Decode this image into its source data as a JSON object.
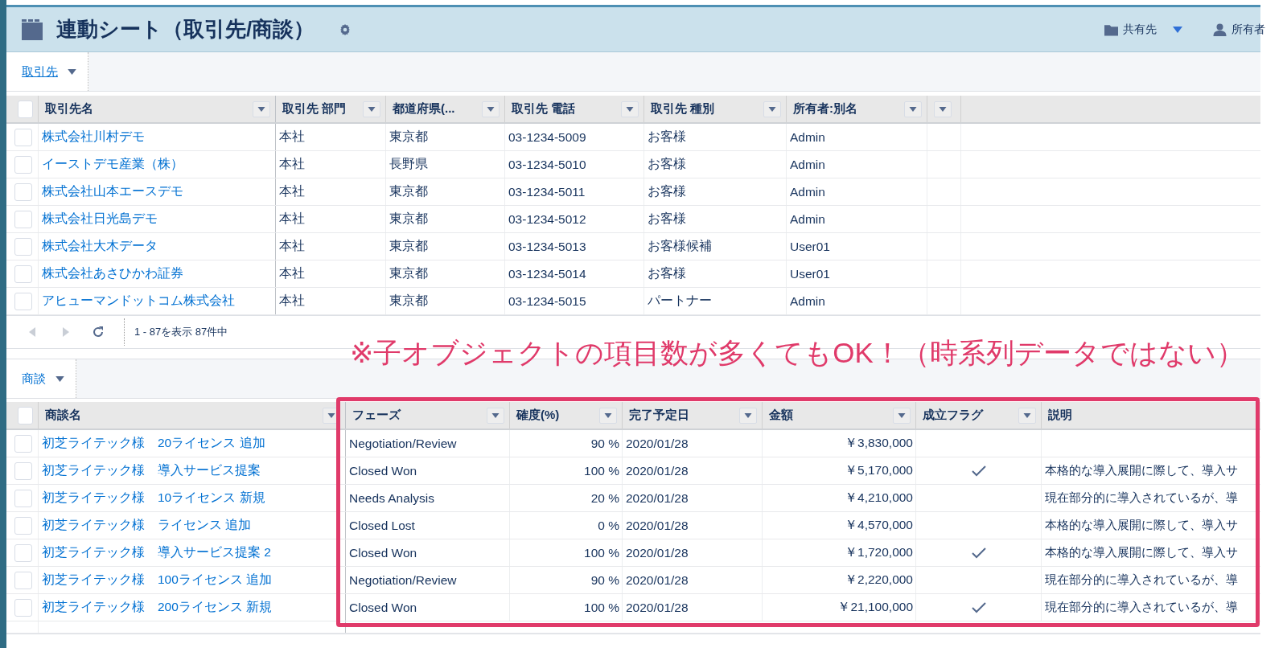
{
  "header": {
    "title": "連動シート（取引先/商談）",
    "share": {
      "label": "共有先"
    },
    "owner": {
      "label": "所有者"
    }
  },
  "accounts": {
    "tab": {
      "label": "取引先",
      "underlined": true
    },
    "all_checked": false,
    "columns": [
      {
        "label": "取引先名"
      },
      {
        "label": "取引先 部門"
      },
      {
        "label": "都道府県(..."
      },
      {
        "label": "取引先 電話"
      },
      {
        "label": "取引先 種別"
      },
      {
        "label": "所有者:別名"
      }
    ],
    "rows": [
      {
        "checked": false,
        "name": "株式会社川村デモ",
        "dept": "本社",
        "pref": "東京都",
        "phone": "03-1234-5009",
        "type": "お客様",
        "owner": "Admin"
      },
      {
        "checked": false,
        "name": "イーストデモ産業（株）",
        "dept": "本社",
        "pref": "長野県",
        "phone": "03-1234-5010",
        "type": "お客様",
        "owner": "Admin"
      },
      {
        "checked": false,
        "name": "株式会社山本エースデモ",
        "dept": "本社",
        "pref": "東京都",
        "phone": "03-1234-5011",
        "type": "お客様",
        "owner": "Admin"
      },
      {
        "checked": false,
        "name": "株式会社日光島デモ",
        "dept": "本社",
        "pref": "東京都",
        "phone": "03-1234-5012",
        "type": "お客様",
        "owner": "Admin"
      },
      {
        "checked": false,
        "name": "株式会社大木データ",
        "dept": "本社",
        "pref": "東京都",
        "phone": "03-1234-5013",
        "type": "お客様候補",
        "owner": "User01"
      },
      {
        "checked": false,
        "name": "株式会社あさひかわ証券",
        "dept": "本社",
        "pref": "東京都",
        "phone": "03-1234-5014",
        "type": "お客様",
        "owner": "User01"
      },
      {
        "checked": false,
        "name": "アヒューマンドットコム株式会社",
        "dept": "本社",
        "pref": "東京都",
        "phone": "03-1234-5015",
        "type": "パートナー",
        "owner": "Admin"
      }
    ],
    "pager": {
      "prev_disabled": true,
      "next_disabled": true,
      "summary": "1 - 87を表示 87件中"
    }
  },
  "annotation": "※子オブジェクトの項目数が多くてもOK！（時系列データではない）",
  "deals": {
    "tab": {
      "label": "商談",
      "underlined": false
    },
    "all_checked": false,
    "columns": [
      {
        "label": "商談名"
      },
      {
        "label": "フェーズ"
      },
      {
        "label": "確度(%)"
      },
      {
        "label": "完了予定日"
      },
      {
        "label": "金額"
      },
      {
        "label": "成立フラグ"
      },
      {
        "label": "説明"
      }
    ],
    "rows": [
      {
        "checked": false,
        "name": "初芝ライテック様　20ライセンス 追加",
        "phase": "Negotiation/Review",
        "probability": "90 %",
        "close_date": "2020/01/28",
        "amount": "￥3,830,000",
        "won": false,
        "description": ""
      },
      {
        "checked": false,
        "name": "初芝ライテック様　導入サービス提案",
        "phase": "Closed Won",
        "probability": "100 %",
        "close_date": "2020/01/28",
        "amount": "￥5,170,000",
        "won": true,
        "description": "本格的な導入展開に際して、導入サ"
      },
      {
        "checked": false,
        "name": "初芝ライテック様　10ライセンス 新規",
        "phase": "Needs Analysis",
        "probability": "20 %",
        "close_date": "2020/01/28",
        "amount": "￥4,210,000",
        "won": false,
        "description": "現在部分的に導入されているが、導"
      },
      {
        "checked": false,
        "name": "初芝ライテック様　ライセンス 追加",
        "phase": "Closed Lost",
        "probability": "0 %",
        "close_date": "2020/01/28",
        "amount": "￥4,570,000",
        "won": false,
        "description": "本格的な導入展開に際して、導入サ"
      },
      {
        "checked": false,
        "name": "初芝ライテック様　導入サービス提案 2",
        "phase": "Closed Won",
        "probability": "100 %",
        "close_date": "2020/01/28",
        "amount": "￥1,720,000",
        "won": true,
        "description": "本格的な導入展開に際して、導入サ"
      },
      {
        "checked": false,
        "name": "初芝ライテック様　100ライセンス 追加",
        "phase": "Negotiation/Review",
        "probability": "90 %",
        "close_date": "2020/01/28",
        "amount": "￥2,220,000",
        "won": false,
        "description": "現在部分的に導入されているが、導"
      },
      {
        "checked": false,
        "name": "初芝ライテック様　200ライセンス 新規",
        "phase": "Closed Won",
        "probability": "100 %",
        "close_date": "2020/01/28",
        "amount": "￥21,100,000",
        "won": true,
        "description": "現在部分的に導入されているが、導"
      }
    ]
  }
}
